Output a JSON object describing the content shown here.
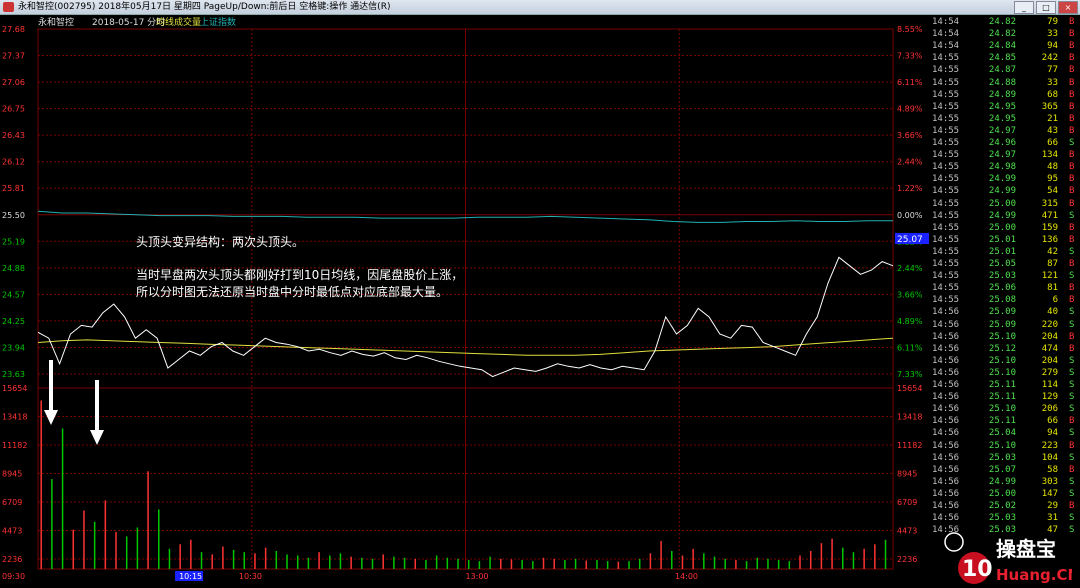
{
  "window": {
    "title": "永和智控(002795) 2018年05月17日 星期四 PageUp/Down:前后日 空格键:操作 通达信(R)"
  },
  "chart_header": {
    "stock": "永和智控",
    "date_label": "2018-05-17 分时",
    "legend": [
      "均线",
      "成交量",
      "上证指数"
    ]
  },
  "annotation": {
    "line1": "头顶头变异结构：两次头顶头。",
    "line2": "当时早盘两次头顶头都刚好打到10日均线，因尾盘股价上涨，",
    "line3": "所以分时图无法还原当时盘中分时最低点对应底部最大量。"
  },
  "watermark": {
    "text": "操盘宝",
    "badge": "10",
    "site": "Huang.CN"
  },
  "chart_data": {
    "type": "line",
    "price_axis_labels": [
      "27.68",
      "27.37",
      "27.06",
      "26.75",
      "26.43",
      "26.12",
      "25.81",
      "25.50",
      "25.19",
      "24.88",
      "24.57",
      "24.25",
      "23.94",
      "23.63"
    ],
    "percent_axis_labels": [
      "8.55%",
      "7.33%",
      "6.11%",
      "4.89%",
      "3.66%",
      "2.44%",
      "1.22%",
      "0.00%",
      "1.22%",
      "2.44%",
      "3.66%",
      "4.89%",
      "6.11%",
      "7.33%"
    ],
    "volume_axis_labels": [
      "15654",
      "13418",
      "11182",
      "8945",
      "6709",
      "4473",
      "2236"
    ],
    "time_labels": [
      "09:30",
      "10:15",
      "10:30",
      "13:00",
      "14:00"
    ],
    "ylim": [
      23.63,
      27.68
    ],
    "prev_close": 25.5,
    "current_price_tag": "25.07",
    "price": [
      24.12,
      24.05,
      23.75,
      24.1,
      24.2,
      24.18,
      24.35,
      24.45,
      24.3,
      24.05,
      24.15,
      24.05,
      23.7,
      23.8,
      23.9,
      23.85,
      23.95,
      24.0,
      23.9,
      23.85,
      23.95,
      24.05,
      24.0,
      23.98,
      23.95,
      23.9,
      23.92,
      23.88,
      23.85,
      23.9,
      23.86,
      23.84,
      23.88,
      23.82,
      23.8,
      23.85,
      23.82,
      23.78,
      23.75,
      23.72,
      23.7,
      23.68,
      23.6,
      23.65,
      23.7,
      23.68,
      23.66,
      23.7,
      23.75,
      23.72,
      23.7,
      23.74,
      23.7,
      23.68,
      23.72,
      23.7,
      23.68,
      23.9,
      24.3,
      24.1,
      24.2,
      24.4,
      24.3,
      24.1,
      24.05,
      24.2,
      24.18,
      24.0,
      23.95,
      23.9,
      23.85,
      24.1,
      24.3,
      24.7,
      25.0,
      24.9,
      24.8,
      24.85,
      24.95,
      24.9
    ],
    "avg_line": [
      24.0,
      24.02,
      24.03,
      24.02,
      24.01,
      24.0,
      23.99,
      23.98,
      23.97,
      23.96,
      23.95,
      23.94,
      23.93,
      23.92,
      23.91,
      23.9,
      23.89,
      23.88,
      23.87,
      23.86,
      23.85,
      23.85,
      23.85,
      23.86,
      23.88,
      23.9,
      23.91,
      23.92,
      23.93,
      23.94,
      23.95,
      23.97,
      23.99,
      24.01,
      24.03,
      24.05
    ],
    "volume": [
      15000,
      8000,
      12500,
      3500,
      5200,
      4200,
      6100,
      3300,
      2900,
      3700,
      8700,
      5300,
      1800,
      2200,
      2600,
      1500,
      1300,
      2000,
      1700,
      1500,
      1400,
      1900,
      1600,
      1300,
      1200,
      1000,
      1500,
      1200,
      1400,
      1100,
      1000,
      900,
      1300,
      1100,
      1000,
      900,
      800,
      1200,
      1000,
      900,
      800,
      700,
      1100,
      900,
      850,
      800,
      700,
      1000,
      900,
      800,
      900,
      750,
      800,
      700,
      650,
      700,
      900,
      1400,
      2500,
      1600,
      1200,
      1800,
      1400,
      1100,
      900,
      800,
      700,
      1000,
      900,
      800,
      700,
      1200,
      1600,
      2300,
      2700,
      1900,
      1500,
      1800,
      2200,
      2600
    ],
    "index_line": [
      25.54,
      25.52,
      25.52,
      25.51,
      25.5,
      25.49,
      25.49,
      25.49,
      25.48,
      25.48,
      25.48,
      25.47,
      25.47,
      25.47,
      25.46,
      25.46,
      25.46,
      25.46,
      25.47,
      25.47,
      25.47,
      25.48,
      25.47,
      25.46,
      25.45,
      25.44,
      25.42,
      25.41,
      25.41,
      25.42,
      25.42,
      25.43,
      25.42,
      25.42,
      25.43,
      25.43
    ],
    "arrows": 2
  },
  "ticks": [
    {
      "time": "14:54",
      "price": "24.82",
      "vol": "79",
      "side": "B"
    },
    {
      "time": "14:54",
      "price": "24.82",
      "vol": "33",
      "side": "B"
    },
    {
      "time": "14:54",
      "price": "24.84",
      "vol": "94",
      "side": "B"
    },
    {
      "time": "14:55",
      "price": "24.85",
      "vol": "242",
      "side": "B"
    },
    {
      "time": "14:55",
      "price": "24.87",
      "vol": "77",
      "side": "B"
    },
    {
      "time": "14:55",
      "price": "24.88",
      "vol": "33",
      "side": "B"
    },
    {
      "time": "14:55",
      "price": "24.89",
      "vol": "68",
      "side": "B"
    },
    {
      "time": "14:55",
      "price": "24.95",
      "vol": "365",
      "side": "B"
    },
    {
      "time": "14:55",
      "price": "24.95",
      "vol": "21",
      "side": "B"
    },
    {
      "time": "14:55",
      "price": "24.97",
      "vol": "43",
      "side": "B"
    },
    {
      "time": "14:55",
      "price": "24.96",
      "vol": "66",
      "side": "S"
    },
    {
      "time": "14:55",
      "price": "24.97",
      "vol": "134",
      "side": "B"
    },
    {
      "time": "14:55",
      "price": "24.98",
      "vol": "48",
      "side": "B"
    },
    {
      "time": "14:55",
      "price": "24.99",
      "vol": "95",
      "side": "B"
    },
    {
      "time": "14:55",
      "price": "24.99",
      "vol": "54",
      "side": "B"
    },
    {
      "time": "14:55",
      "price": "25.00",
      "vol": "315",
      "side": "B"
    },
    {
      "time": "14:55",
      "price": "24.99",
      "vol": "471",
      "side": "S"
    },
    {
      "time": "14:55",
      "price": "25.00",
      "vol": "159",
      "side": "B"
    },
    {
      "time": "14:55",
      "price": "25.01",
      "vol": "136",
      "side": "B"
    },
    {
      "time": "14:55",
      "price": "25.01",
      "vol": "42",
      "side": "S"
    },
    {
      "time": "14:55",
      "price": "25.05",
      "vol": "87",
      "side": "B"
    },
    {
      "time": "14:55",
      "price": "25.03",
      "vol": "121",
      "side": "S"
    },
    {
      "time": "14:55",
      "price": "25.06",
      "vol": "81",
      "side": "B"
    },
    {
      "time": "14:55",
      "price": "25.08",
      "vol": "6",
      "side": "B"
    },
    {
      "time": "14:56",
      "price": "25.09",
      "vol": "40",
      "side": "S"
    },
    {
      "time": "14:56",
      "price": "25.09",
      "vol": "220",
      "side": "S"
    },
    {
      "time": "14:56",
      "price": "25.10",
      "vol": "204",
      "side": "B"
    },
    {
      "time": "14:56",
      "price": "25.12",
      "vol": "474",
      "side": "B"
    },
    {
      "time": "14:56",
      "price": "25.10",
      "vol": "204",
      "side": "S"
    },
    {
      "time": "14:56",
      "price": "25.10",
      "vol": "279",
      "side": "S"
    },
    {
      "time": "14:56",
      "price": "25.11",
      "vol": "114",
      "side": "S"
    },
    {
      "time": "14:56",
      "price": "25.11",
      "vol": "129",
      "side": "S"
    },
    {
      "time": "14:56",
      "price": "25.10",
      "vol": "206",
      "side": "S"
    },
    {
      "time": "14:56",
      "price": "25.11",
      "vol": "66",
      "side": "B"
    },
    {
      "time": "14:56",
      "price": "25.04",
      "vol": "94",
      "side": "S"
    },
    {
      "time": "14:56",
      "price": "25.10",
      "vol": "223",
      "side": "B"
    },
    {
      "time": "14:56",
      "price": "25.03",
      "vol": "104",
      "side": "S"
    },
    {
      "time": "14:56",
      "price": "25.07",
      "vol": "58",
      "side": "B"
    },
    {
      "time": "14:56",
      "price": "24.99",
      "vol": "303",
      "side": "S"
    },
    {
      "time": "14:56",
      "price": "25.00",
      "vol": "147",
      "side": "S"
    },
    {
      "time": "14:56",
      "price": "25.02",
      "vol": "29",
      "side": "B"
    },
    {
      "time": "14:56",
      "price": "25.03",
      "vol": "31",
      "side": "S"
    },
    {
      "time": "14:56",
      "price": "25.03",
      "vol": "47",
      "side": "S"
    }
  ],
  "colors": {
    "bg": "#000000",
    "grid": "#7a0000",
    "up": "#ff3333",
    "down": "#00c800",
    "price_line": "#ffffff",
    "avg_line": "#e0e040",
    "index_line": "#20b0b0",
    "annotation": "#ffffff",
    "tick_time": "#c0c0c0",
    "volume_text": "#e6e600"
  }
}
